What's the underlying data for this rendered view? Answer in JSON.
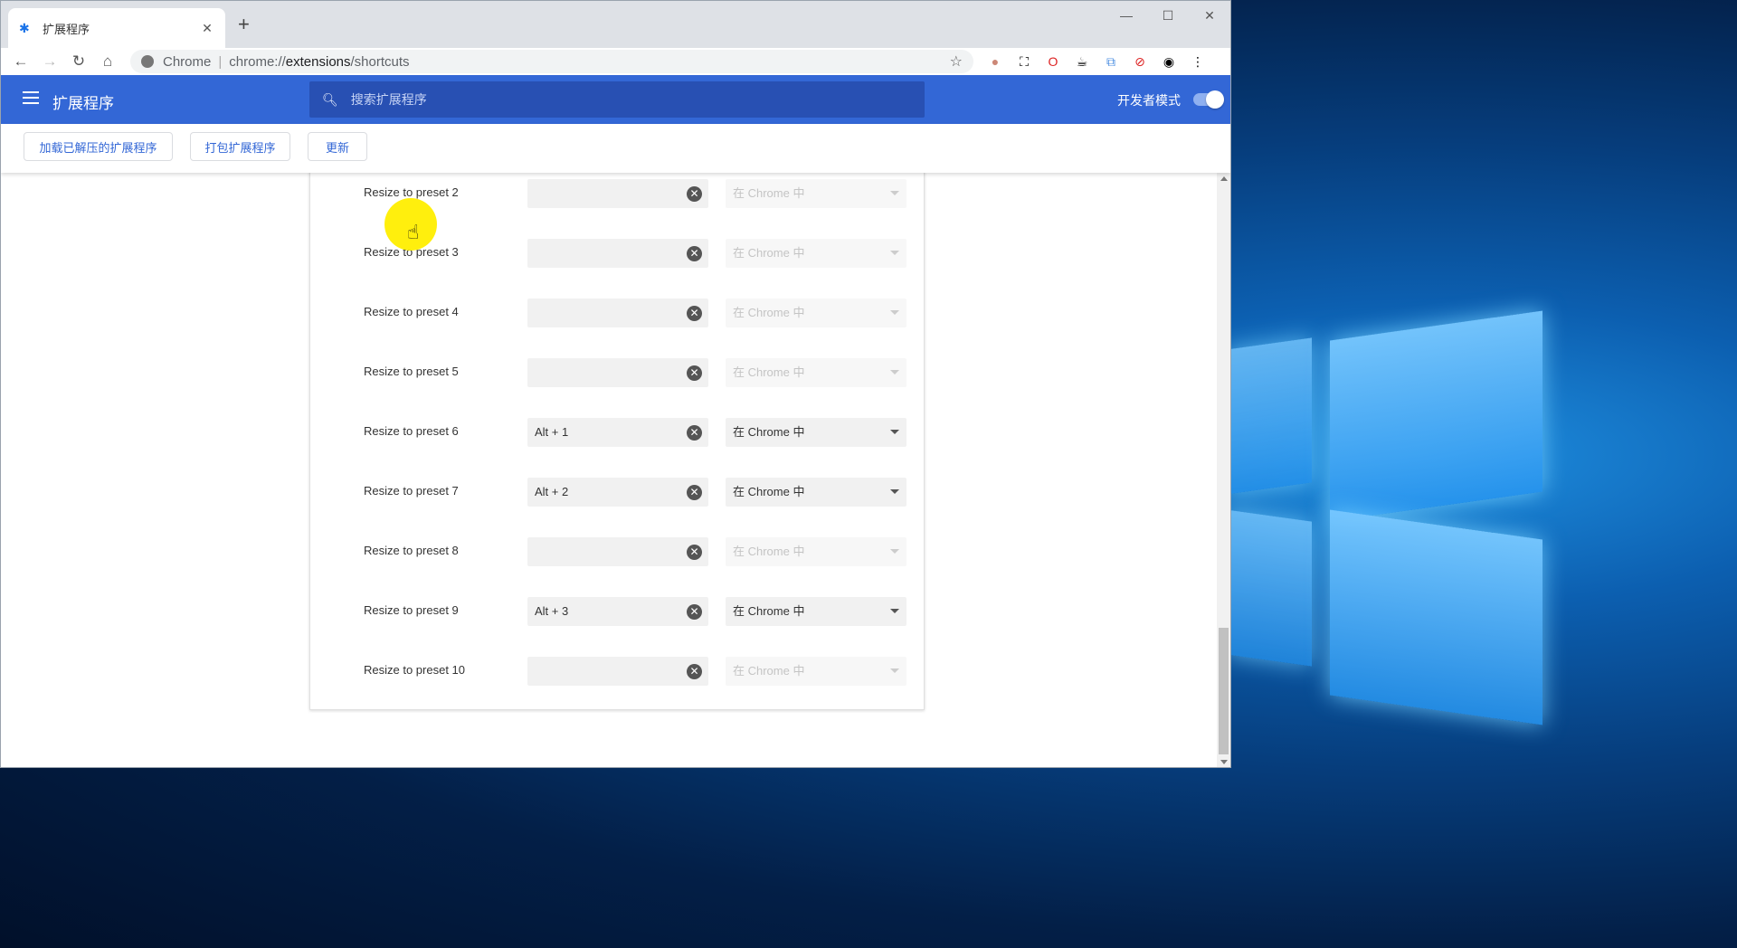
{
  "browser": {
    "tab_title": "扩展程序",
    "omnibox_scheme": "Chrome",
    "omnibox_url_prefix": "chrome://",
    "omnibox_url_host": "extensions",
    "omnibox_url_path": "/shortcuts"
  },
  "header": {
    "title": "扩展程序",
    "search_placeholder": "搜索扩展程序",
    "dev_mode_label": "开发者模式",
    "dev_mode_on": true
  },
  "toolbar": {
    "load_unpacked": "加载已解压的扩展程序",
    "pack": "打包扩展程序",
    "update": "更新"
  },
  "shortcuts": [
    {
      "label": "Resize to preset 2",
      "shortcut": "",
      "scope": "在 Chrome 中",
      "enabled": false
    },
    {
      "label": "Resize to preset 3",
      "shortcut": "",
      "scope": "在 Chrome 中",
      "enabled": false
    },
    {
      "label": "Resize to preset 4",
      "shortcut": "",
      "scope": "在 Chrome 中",
      "enabled": false
    },
    {
      "label": "Resize to preset 5",
      "shortcut": "",
      "scope": "在 Chrome 中",
      "enabled": false
    },
    {
      "label": "Resize to preset 6",
      "shortcut": "Alt + 1",
      "scope": "在 Chrome 中",
      "enabled": true
    },
    {
      "label": "Resize to preset 7",
      "shortcut": "Alt + 2",
      "scope": "在 Chrome 中",
      "enabled": true
    },
    {
      "label": "Resize to preset 8",
      "shortcut": "",
      "scope": "在 Chrome 中",
      "enabled": false
    },
    {
      "label": "Resize to preset 9",
      "shortcut": "Alt + 3",
      "scope": "在 Chrome 中",
      "enabled": true
    },
    {
      "label": "Resize to preset 10",
      "shortcut": "",
      "scope": "在 Chrome 中",
      "enabled": false
    }
  ],
  "colors": {
    "header_bg": "#3367d6",
    "accent": "#3367d6"
  }
}
